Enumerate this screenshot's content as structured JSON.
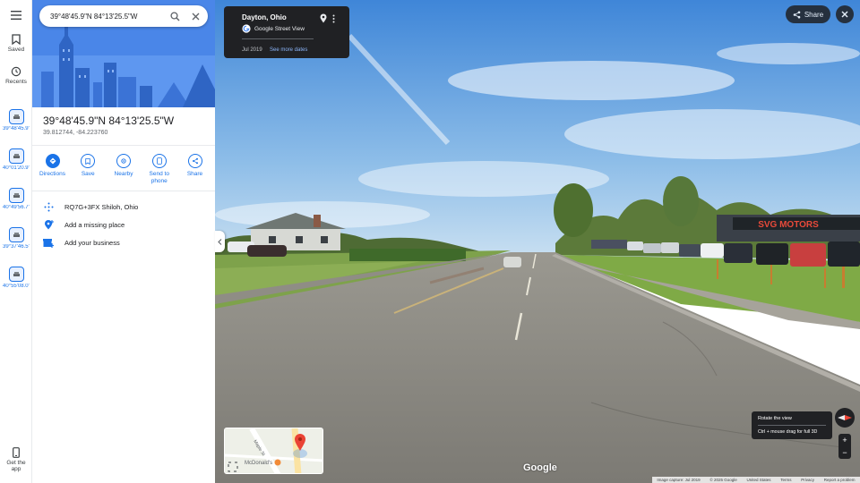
{
  "search": {
    "value": "39°48'45.9\"N 84°13'25.5\"W"
  },
  "rail": {
    "menu_icon": "menu-icon",
    "saved_label": "Saved",
    "recents_label": "Recents",
    "recents": [
      {
        "label": "39°48'45.9\"N"
      },
      {
        "label": "40°01'20.9\"N"
      },
      {
        "label": "40°49'56.7\"N"
      },
      {
        "label": "39°37'46.5\"N"
      },
      {
        "label": "40°55'08.0\"N"
      }
    ],
    "get_app_label": "Get the app"
  },
  "place": {
    "title": "39°48'45.9\"N 84°13'25.5\"W",
    "coords": "39.812744, -84.223760"
  },
  "actions": [
    {
      "label": "Directions",
      "icon": "directions-icon"
    },
    {
      "label": "Save",
      "icon": "bookmark-icon"
    },
    {
      "label": "Nearby",
      "icon": "nearby-icon"
    },
    {
      "label": "Send to phone",
      "icon": "phone-icon"
    },
    {
      "label": "Share",
      "icon": "share-icon"
    }
  ],
  "info": {
    "plus_code": "RQ7G+3FX Shiloh, Ohio",
    "add_missing": "Add a missing place",
    "add_business": "Add your business"
  },
  "streetview": {
    "city": "Dayton, Ohio",
    "source": "Google Street View",
    "date": "Jul 2019",
    "more_dates": "See more dates",
    "share_label": "Share",
    "sign_text": "SVG MOTORS",
    "tooltip_title": "Rotate the view",
    "tooltip_hint": "Ctrl + mouse drag for full 3D",
    "minimap_label": "McDonald's",
    "minimap_street": "Maple St",
    "google_logo": "Google",
    "footer": {
      "capture": "Image capture: Jul 2019",
      "copyright": "© 2025 Google",
      "country": "United States",
      "terms": "Terms",
      "privacy": "Privacy",
      "report": "Report a problem"
    }
  },
  "colors": {
    "accent": "#1a73e8",
    "dark_ui": "#202124",
    "sign_red": "#c0392b"
  }
}
